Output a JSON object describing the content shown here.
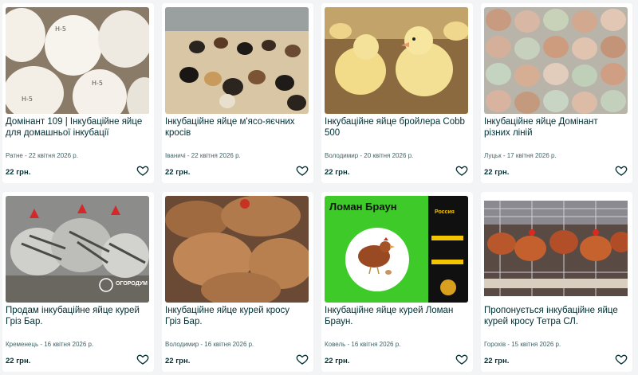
{
  "listings": [
    {
      "title": "Домінант 109 | Інкубаційне яйце для домашньої інкубації",
      "location_date": "Ратне - 22 квітня 2026 р.",
      "price": "22 грн.",
      "image": "white-eggs-in-tray"
    },
    {
      "title": "Інкубаційне яйце м'ясо-яєчних кросів",
      "location_date": "Іваничі - 22 квітня 2026 р.",
      "price": "22 грн.",
      "image": "chicks-in-brooder"
    },
    {
      "title": "Інкубаційне яйце бройлера Cobb 500",
      "location_date": "Володимир - 20 квітня 2026 р.",
      "price": "22 грн.",
      "image": "yellow-broiler-chicks"
    },
    {
      "title": "Інкубаційне яйце Домінант різних ліній",
      "location_date": "Луцьк - 17 квітня 2026 р.",
      "price": "22 грн.",
      "image": "mixed-color-eggs-in-tray"
    },
    {
      "title": "Продам інкубаційне яйце курей Гріз Бар.",
      "location_date": "Кременець - 16 квітня 2026 р.",
      "price": "22 грн.",
      "image": "barred-hens",
      "watermark": "ОГОРОДУМ"
    },
    {
      "title": "Інкубаційне яйце курей кросу Гріз Бар.",
      "location_date": "Володимир - 16 квітня 2026 р.",
      "price": "22 грн.",
      "image": "brown-hens"
    },
    {
      "title": "Інкубаційне яйце курей Ломан Браун.",
      "location_date": "Ковель - 16 квітня 2026 р.",
      "price": "22 грн.",
      "image": "loman-brown-banner",
      "banner_text": "Ломан Браун",
      "banner_side_text": "Россия"
    },
    {
      "title": "Пропонується інкубаційне яйце курей кросу Тетра СЛ.",
      "location_date": "Горохів - 15 квітня 2026 р.",
      "price": "22 грн.",
      "image": "hens-in-cage"
    }
  ],
  "favorite_icon": "heart-outline-icon",
  "colors": {
    "text": "#002f34",
    "meta": "#406367",
    "background": "#f2f4f5",
    "card": "#ffffff"
  }
}
